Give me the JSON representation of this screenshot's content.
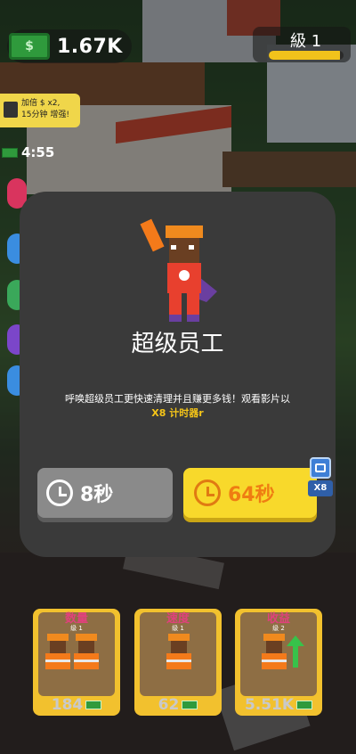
{
  "hud": {
    "cash_value": "1.67K",
    "cash_icon": "cash-icon",
    "level_label": "級 1",
    "level_progress": 0.95
  },
  "boost": {
    "line1": "加倍 $ x2,",
    "line2": "15分钟 增强!"
  },
  "timer": {
    "value": "4:55"
  },
  "modal": {
    "title": "超级员工",
    "description": "呼唤超级员工更快速清理并且赚更多钱！观看影片以",
    "highlight": "X8 计时器r",
    "free_button": {
      "label": "8秒",
      "icon": "clock-icon"
    },
    "ad_button": {
      "label": "64秒",
      "icon": "clock-icon",
      "badge": "X8"
    }
  },
  "cards": [
    {
      "title": "数量",
      "level": "级 1",
      "cost": "184"
    },
    {
      "title": "速度",
      "level": "级 1",
      "cost": "62"
    },
    {
      "title": "收益",
      "level": "级 2",
      "cost": "5.51K"
    }
  ],
  "colors": {
    "accent_yellow": "#f8d92b",
    "accent_orange": "#ef7d12",
    "modal_bg": "#3a3a3a",
    "card_title_pink": "#e0417c"
  }
}
